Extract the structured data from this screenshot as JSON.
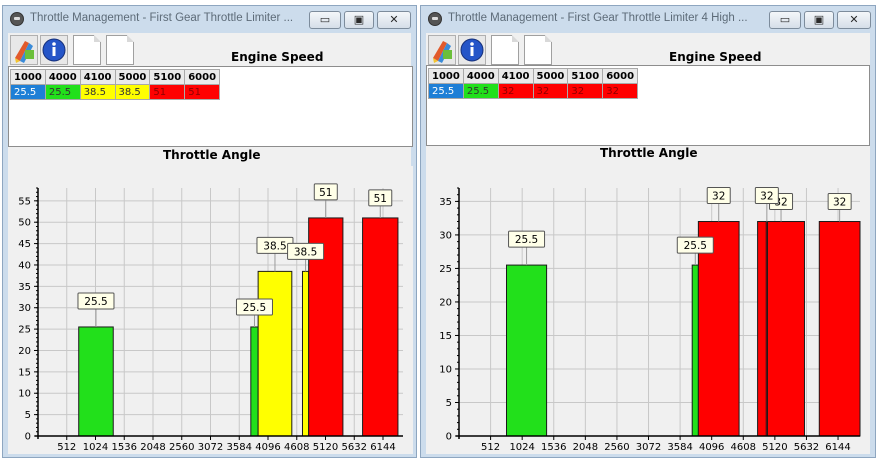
{
  "windows": [
    {
      "title": "Throttle Management - First Gear Throttle Limiter ...",
      "buttons": {
        "minimize": "▭",
        "maximize": "▣",
        "close": "✕"
      },
      "grid_title": "Engine Speed",
      "table": {
        "headers": [
          "1000",
          "4000",
          "4100",
          "5000",
          "5100",
          "6000"
        ],
        "values": [
          "25.5",
          "25.5",
          "38.5",
          "38.5",
          "51",
          "51"
        ],
        "colors": [
          "#1e7fd6",
          "#22e01b",
          "#ffff00",
          "#ffff00",
          "#ff0000",
          "#ff0000"
        ]
      },
      "chart_data": {
        "type": "bar",
        "title": "Throttle Angle",
        "x_ticks": [
          "512",
          "1024",
          "1536",
          "2048",
          "2560",
          "3072",
          "3584",
          "4096",
          "4608",
          "5120",
          "5632",
          "6144"
        ],
        "y_ticks": [
          "0",
          "5",
          "10",
          "15",
          "20",
          "25",
          "30",
          "35",
          "40",
          "45",
          "50",
          "55"
        ],
        "xlim": [
          0,
          6500
        ],
        "ylim": [
          0,
          58
        ],
        "grid": true,
        "bars": [
          {
            "x_from": 725,
            "x_to": 1340,
            "value": 25.5,
            "color": "#22e01b",
            "label": "25.5"
          },
          {
            "x_from": 3790,
            "x_to": 3920,
            "value": 25.5,
            "color": "#22e01b",
            "label": "25.5"
          },
          {
            "x_from": 3920,
            "x_to": 4520,
            "value": 38.5,
            "color": "#ffff00",
            "label": "38.5"
          },
          {
            "x_from": 4710,
            "x_to": 4820,
            "value": 38.5,
            "color": "#ffff00",
            "label": "38.5"
          },
          {
            "x_from": 4820,
            "x_to": 5430,
            "value": 51,
            "color": "#ff0000",
            "label": "51"
          },
          {
            "x_from": 5780,
            "x_to": 6410,
            "value": 51,
            "color": "#ff0000",
            "label": "51"
          }
        ]
      }
    },
    {
      "title": "Throttle Management - First Gear Throttle Limiter 4 High ...",
      "buttons": {
        "minimize": "▭",
        "maximize": "▣",
        "close": "✕"
      },
      "grid_title": "Engine Speed",
      "table": {
        "headers": [
          "1000",
          "4000",
          "4100",
          "5000",
          "5100",
          "6000"
        ],
        "values": [
          "25.5",
          "25.5",
          "32",
          "32",
          "32",
          "32"
        ],
        "colors": [
          "#1e7fd6",
          "#22e01b",
          "#ff0000",
          "#ff0000",
          "#ff0000",
          "#ff0000"
        ]
      },
      "chart_data": {
        "type": "bar",
        "title": "Throttle Angle",
        "x_ticks": [
          "512",
          "1024",
          "1536",
          "2048",
          "2560",
          "3072",
          "3584",
          "4096",
          "4608",
          "5120",
          "5632",
          "6144"
        ],
        "y_ticks": [
          "0",
          "5",
          "10",
          "15",
          "20",
          "25",
          "30",
          "35"
        ],
        "xlim": [
          0,
          6500
        ],
        "ylim": [
          0,
          37
        ],
        "grid": true,
        "bars": [
          {
            "x_from": 770,
            "x_to": 1420,
            "value": 25.5,
            "color": "#22e01b",
            "label": "25.5"
          },
          {
            "x_from": 3780,
            "x_to": 3880,
            "value": 25.5,
            "color": "#22e01b",
            "label": "25.5"
          },
          {
            "x_from": 3880,
            "x_to": 4540,
            "value": 32,
            "color": "#ff0000",
            "label": "32"
          },
          {
            "x_from": 4840,
            "x_to": 5600,
            "value": 32,
            "color": "#ff0000",
            "label": "32"
          },
          {
            "x_from": 4980,
            "x_to": 5000,
            "value": 32,
            "color": "#ff0000",
            "label": "32"
          },
          {
            "x_from": 5840,
            "x_to": 6500,
            "value": 32,
            "color": "#ff0000",
            "label": "32"
          }
        ]
      }
    }
  ]
}
